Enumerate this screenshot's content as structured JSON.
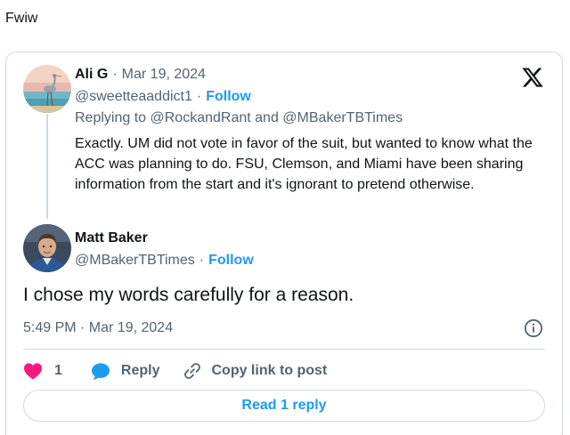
{
  "intro_text": "Fwiw",
  "quoted_tweet": {
    "author_name": "Ali G",
    "date": "Mar 19, 2024",
    "handle": "@sweetteaaddict1",
    "follow_label": "Follow",
    "replying_prefix": "Replying to",
    "reply_mention_1": "@RockandRant",
    "reply_and": "and",
    "reply_mention_2": "@MBakerTBTimes",
    "text": "Exactly. UM did not vote in favor of the suit, but wanted to know what the ACC was planning to do. FSU, Clemson, and Miami have been sharing information from the start and it's ignorant to pretend otherwise."
  },
  "main_tweet": {
    "author_name": "Matt Baker",
    "handle": "@MBakerTBTimes",
    "follow_label": "Follow",
    "text": "I chose my words carefully for a reason.",
    "timestamp": "5:49 PM · Mar 19, 2024"
  },
  "actions": {
    "like_count": "1",
    "reply_label": "Reply",
    "copy_link_label": "Copy link to post"
  },
  "read_replies_label": "Read 1 reply",
  "separator_dot": "·",
  "icons": {
    "brand": "x-logo-icon",
    "info": "info-icon",
    "like": "heart-icon",
    "reply": "speech-bubble-icon",
    "copy": "link-icon"
  },
  "colors": {
    "accent": "#1d9bf0",
    "like": "#f91880",
    "muted": "#536471",
    "border": "#cfd9de"
  }
}
